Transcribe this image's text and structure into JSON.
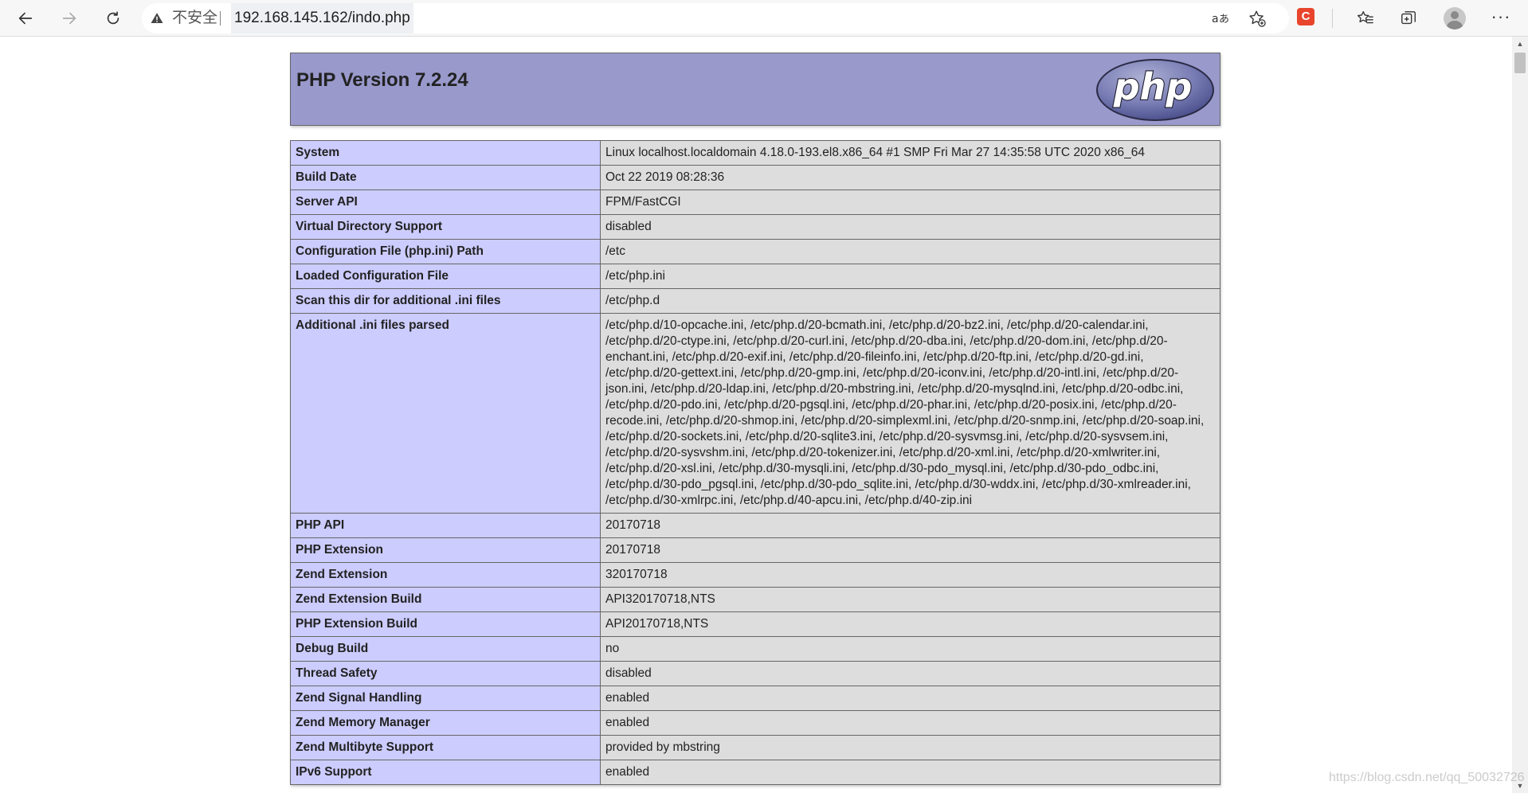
{
  "browser": {
    "address_bar": {
      "security_label": "不安全",
      "url": "192.168.145.162/indo.php"
    },
    "icons": [
      "back-icon",
      "forward-icon",
      "refresh-icon",
      "warning-icon",
      "read-aloud-icon",
      "add-favorite-icon",
      "extension-icon",
      "favorites-icon",
      "collections-icon",
      "profile-icon",
      "more-icon"
    ],
    "extension_label": "C"
  },
  "phpinfo": {
    "title": "PHP Version 7.2.24",
    "logo_text": "php",
    "rows": [
      {
        "key": "System",
        "value": "Linux localhost.localdomain 4.18.0-193.el8.x86_64 #1 SMP Fri Mar 27 14:35:58 UTC 2020 x86_64"
      },
      {
        "key": "Build Date",
        "value": "Oct 22 2019 08:28:36"
      },
      {
        "key": "Server API",
        "value": "FPM/FastCGI"
      },
      {
        "key": "Virtual Directory Support",
        "value": "disabled"
      },
      {
        "key": "Configuration File (php.ini) Path",
        "value": "/etc"
      },
      {
        "key": "Loaded Configuration File",
        "value": "/etc/php.ini"
      },
      {
        "key": "Scan this dir for additional .ini files",
        "value": "/etc/php.d"
      },
      {
        "key": "Additional .ini files parsed",
        "value": "/etc/php.d/10-opcache.ini, /etc/php.d/20-bcmath.ini, /etc/php.d/20-bz2.ini, /etc/php.d/20-calendar.ini, /etc/php.d/20-ctype.ini, /etc/php.d/20-curl.ini, /etc/php.d/20-dba.ini, /etc/php.d/20-dom.ini, /etc/php.d/20-enchant.ini, /etc/php.d/20-exif.ini, /etc/php.d/20-fileinfo.ini, /etc/php.d/20-ftp.ini, /etc/php.d/20-gd.ini, /etc/php.d/20-gettext.ini, /etc/php.d/20-gmp.ini, /etc/php.d/20-iconv.ini, /etc/php.d/20-intl.ini, /etc/php.d/20-json.ini, /etc/php.d/20-ldap.ini, /etc/php.d/20-mbstring.ini, /etc/php.d/20-mysqlnd.ini, /etc/php.d/20-odbc.ini, /etc/php.d/20-pdo.ini, /etc/php.d/20-pgsql.ini, /etc/php.d/20-phar.ini, /etc/php.d/20-posix.ini, /etc/php.d/20-recode.ini, /etc/php.d/20-shmop.ini, /etc/php.d/20-simplexml.ini, /etc/php.d/20-snmp.ini, /etc/php.d/20-soap.ini, /etc/php.d/20-sockets.ini, /etc/php.d/20-sqlite3.ini, /etc/php.d/20-sysvmsg.ini, /etc/php.d/20-sysvsem.ini, /etc/php.d/20-sysvshm.ini, /etc/php.d/20-tokenizer.ini, /etc/php.d/20-xml.ini, /etc/php.d/20-xmlwriter.ini, /etc/php.d/20-xsl.ini, /etc/php.d/30-mysqli.ini, /etc/php.d/30-pdo_mysql.ini, /etc/php.d/30-pdo_odbc.ini, /etc/php.d/30-pdo_pgsql.ini, /etc/php.d/30-pdo_sqlite.ini, /etc/php.d/30-wddx.ini, /etc/php.d/30-xmlreader.ini, /etc/php.d/30-xmlrpc.ini, /etc/php.d/40-apcu.ini, /etc/php.d/40-zip.ini"
      },
      {
        "key": "PHP API",
        "value": "20170718"
      },
      {
        "key": "PHP Extension",
        "value": "20170718"
      },
      {
        "key": "Zend Extension",
        "value": "320170718"
      },
      {
        "key": "Zend Extension Build",
        "value": "API320170718,NTS"
      },
      {
        "key": "PHP Extension Build",
        "value": "API20170718,NTS"
      },
      {
        "key": "Debug Build",
        "value": "no"
      },
      {
        "key": "Thread Safety",
        "value": "disabled"
      },
      {
        "key": "Zend Signal Handling",
        "value": "enabled"
      },
      {
        "key": "Zend Memory Manager",
        "value": "enabled"
      },
      {
        "key": "Zend Multibyte Support",
        "value": "provided by mbstring"
      },
      {
        "key": "IPv6 Support",
        "value": "enabled"
      }
    ]
  },
  "watermark": "https://blog.csdn.net/qq_50032726",
  "colors": {
    "header_bg": "#9999cc",
    "key_cell_bg": "#ccccff",
    "value_cell_bg": "#dddddd",
    "border": "#666666"
  }
}
